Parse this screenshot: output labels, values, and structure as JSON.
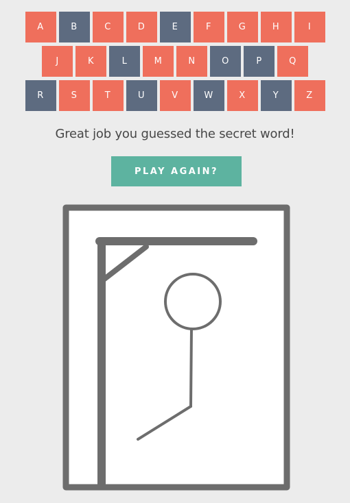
{
  "keyboard": {
    "rows": [
      [
        {
          "letter": "A",
          "state": "unused"
        },
        {
          "letter": "B",
          "state": "used"
        },
        {
          "letter": "C",
          "state": "unused"
        },
        {
          "letter": "D",
          "state": "unused"
        },
        {
          "letter": "E",
          "state": "used"
        },
        {
          "letter": "F",
          "state": "unused"
        },
        {
          "letter": "G",
          "state": "unused"
        },
        {
          "letter": "H",
          "state": "unused"
        },
        {
          "letter": "I",
          "state": "unused"
        }
      ],
      [
        {
          "letter": "J",
          "state": "unused"
        },
        {
          "letter": "K",
          "state": "unused"
        },
        {
          "letter": "L",
          "state": "used"
        },
        {
          "letter": "M",
          "state": "unused"
        },
        {
          "letter": "N",
          "state": "unused"
        },
        {
          "letter": "O",
          "state": "used"
        },
        {
          "letter": "P",
          "state": "used"
        },
        {
          "letter": "Q",
          "state": "unused"
        }
      ],
      [
        {
          "letter": "R",
          "state": "used"
        },
        {
          "letter": "S",
          "state": "unused"
        },
        {
          "letter": "T",
          "state": "unused"
        },
        {
          "letter": "U",
          "state": "used"
        },
        {
          "letter": "V",
          "state": "unused"
        },
        {
          "letter": "W",
          "state": "used"
        },
        {
          "letter": "X",
          "state": "unused"
        },
        {
          "letter": "Y",
          "state": "used"
        },
        {
          "letter": "Z",
          "state": "unused"
        }
      ]
    ]
  },
  "message": "Great job you guessed the secret word!",
  "play_again_label": "PLAY AGAIN?",
  "colors": {
    "unused_key": "#ef6f5c",
    "used_key": "#5d6b80",
    "button": "#5db3a0",
    "gallows": "#6d6d6d",
    "background": "#ececec"
  },
  "hangman": {
    "parts_drawn": [
      "head",
      "body",
      "left-leg"
    ]
  }
}
